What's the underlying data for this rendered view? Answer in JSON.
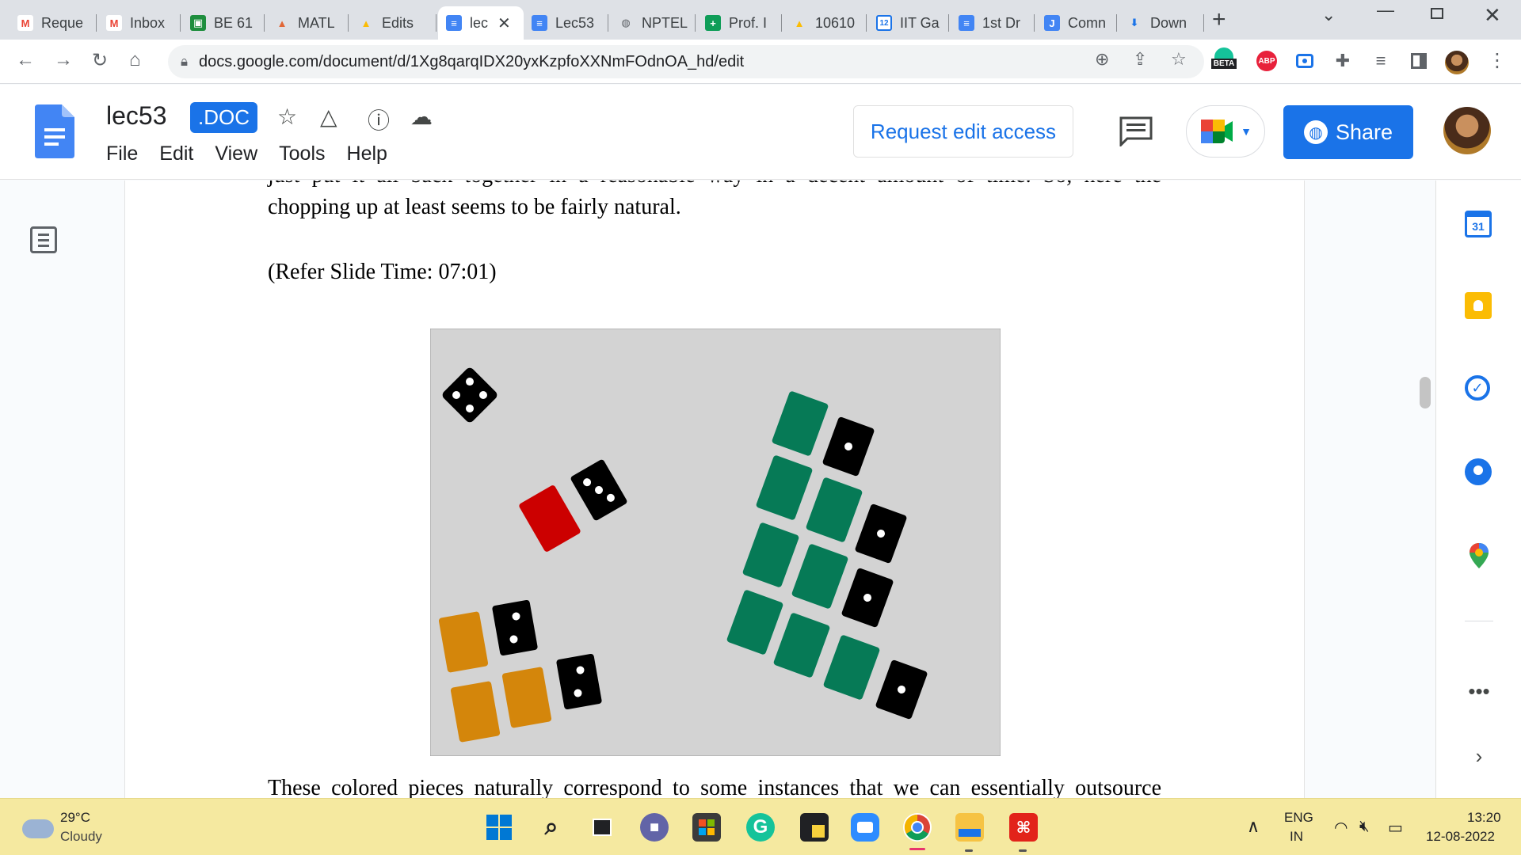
{
  "browser": {
    "tabs": [
      {
        "label": "Reque",
        "icon": "gmail-icon"
      },
      {
        "label": "Inbox",
        "icon": "gmail-icon"
      },
      {
        "label": "BE 61",
        "icon": "classroom-icon"
      },
      {
        "label": "MATL",
        "icon": "matlab-icon"
      },
      {
        "label": "Edits",
        "icon": "drive-icon"
      },
      {
        "label": "lec",
        "icon": "docs-icon",
        "active": true
      },
      {
        "label": "Lec53",
        "icon": "docs-icon"
      },
      {
        "label": "NPTEL",
        "icon": "globe-icon"
      },
      {
        "label": "Prof. I",
        "icon": "sheets-plus-icon"
      },
      {
        "label": "10610",
        "icon": "drive-icon"
      },
      {
        "label": "IIT Ga",
        "icon": "calendar-icon"
      },
      {
        "label": "1st Dr",
        "icon": "docs-icon"
      },
      {
        "label": "Comn",
        "icon": "jamboard-icon"
      },
      {
        "label": "Down",
        "icon": "download-icon"
      }
    ],
    "calendar_tab_number": "12",
    "url": "docs.google.com/document/d/1Xg8qarqIDX20yxKzpfoXXNmFOdnOA_hd/edit",
    "beta_label": "BETA",
    "abp_label": "ABP"
  },
  "docs": {
    "title": "lec53",
    "badge": ".DOC",
    "menu": [
      "File",
      "Edit",
      "View",
      "Tools",
      "Help"
    ],
    "request_edit": "Request edit access",
    "share": "Share"
  },
  "document": {
    "line1": "just put it all back together in a reasonable way in a decent amount of time. So, here the",
    "line2": "chopping up at least seems to be fairly natural.",
    "slide_ref": "(Refer Slide Time: 07:01)",
    "line3": "These colored pieces naturally correspond to some instances that we can essentially outsource"
  },
  "side_panel": {
    "calendar_day": "31"
  },
  "taskbar": {
    "temperature": "29°C",
    "weather": "Cloudy",
    "lang1": "ENG",
    "lang2": "IN",
    "time": "13:20",
    "date": "12-08-2022"
  },
  "colors": {
    "accent": "#1a73e8",
    "slide_bg": "#d3d3d3",
    "piece_green": "#067a56",
    "piece_red": "#cc0000",
    "piece_orange": "#d4860b",
    "piece_black": "#000000"
  }
}
